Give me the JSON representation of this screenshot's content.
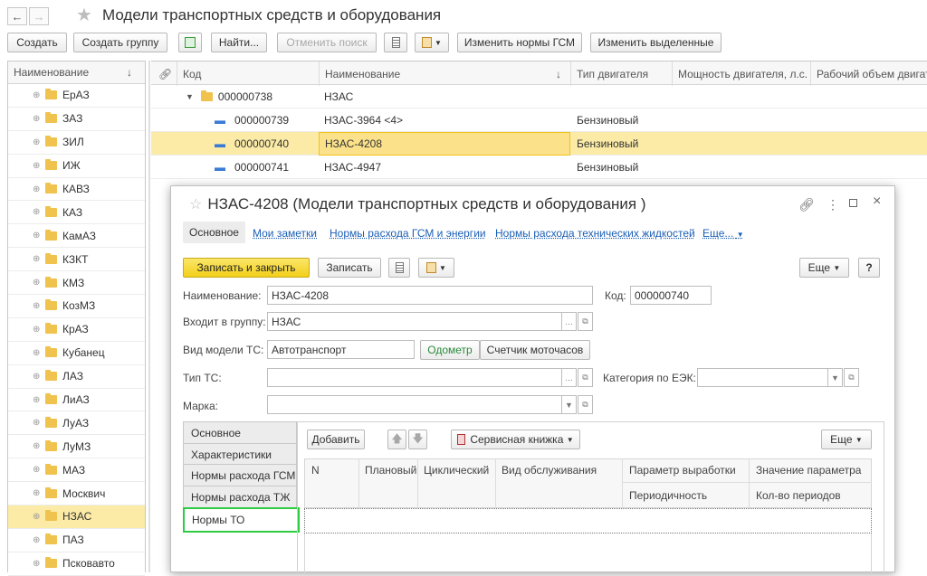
{
  "window": {
    "title": "Модели транспортных средств и оборудования"
  },
  "toolbar": {
    "create": "Создать",
    "create_group": "Создать группу",
    "find": "Найти...",
    "cancel_search": "Отменить поиск",
    "change_fuel_norms": "Изменить нормы ГСМ",
    "change_selected": "Изменить выделенные"
  },
  "tree": {
    "header": "Наименование",
    "sort_arrow": "↓",
    "items": [
      "ЕрАЗ",
      "ЗАЗ",
      "ЗИЛ",
      "ИЖ",
      "КАВЗ",
      "КАЗ",
      "КамАЗ",
      "КЗКТ",
      "КМЗ",
      "КозМЗ",
      "КрАЗ",
      "Кубанец",
      "ЛАЗ",
      "ЛиАЗ",
      "ЛуАЗ",
      "ЛуМЗ",
      "МАЗ",
      "Москвич",
      "НЗАС",
      "ПАЗ",
      "Псковавто"
    ],
    "selected": "НЗАС"
  },
  "grid": {
    "columns": [
      "Код",
      "Наименование",
      "Тип двигателя",
      "Мощность двигателя, л.с.",
      "Рабочий объем двигателя"
    ],
    "sort_arrow": "↓",
    "rows": [
      {
        "code": "000000738",
        "name": "НЗАС",
        "engine": "",
        "is_group": true
      },
      {
        "code": "000000739",
        "name": "НЗАС-3964 <4>",
        "engine": "Бензиновый",
        "is_group": false
      },
      {
        "code": "000000740",
        "name": "НЗАС-4208",
        "engine": "Бензиновый",
        "is_group": false,
        "selected": true
      },
      {
        "code": "000000741",
        "name": "НЗАС-4947",
        "engine": "Бензиновый",
        "is_group": false
      }
    ]
  },
  "modal": {
    "title": "НЗАС-4208 (Модели транспортных средств и оборудования )",
    "tabs": [
      "Основное",
      "Мои заметки",
      "Нормы расхода ГСМ и энергии",
      "Нормы расхода технических жидкостей",
      "Еще..."
    ],
    "save_close": "Записать и закрыть",
    "save": "Записать",
    "more": "Еще",
    "help": "?",
    "fields": {
      "name_label": "Наименование:",
      "name_value": "НЗАС-4208",
      "code_label": "Код:",
      "code_value": "000000740",
      "group_label": "Входит в группу:",
      "group_value": "НЗАС",
      "model_kind_label": "Вид модели ТС:",
      "model_kind_value": "Автотранспорт",
      "odometer": "Одометр",
      "motohours": "Счетчик моточасов",
      "vehicle_type_label": "Тип ТС:",
      "vehicle_type_value": "",
      "eek_label": "Категория по ЕЭК:",
      "eek_value": "",
      "brand_label": "Марка:",
      "brand_value": ""
    },
    "side_tabs": [
      "Основное",
      "Характеристики",
      "Нормы расхода ГСМ",
      "Нормы расхода ТЖ",
      "Нормы ТО"
    ],
    "active_side_tab": "Нормы ТО",
    "table_toolbar": {
      "add": "Добавить",
      "service_book": "Сервисная книжка",
      "more": "Еще"
    },
    "table_columns": {
      "n": "N",
      "planned": "Плановый",
      "cyclic": "Циклический",
      "service_kind": "Вид обслуживания",
      "param": "Параметр выработки",
      "param_value": "Значение параметра",
      "periodicity": "Периодичность",
      "periods": "Кол-во периодов"
    }
  },
  "colors": {
    "selection": "#fbeba6",
    "accent_yellow": "#f2cf1a",
    "link": "#1b5fb5",
    "highlight_green": "#2ecc40"
  }
}
